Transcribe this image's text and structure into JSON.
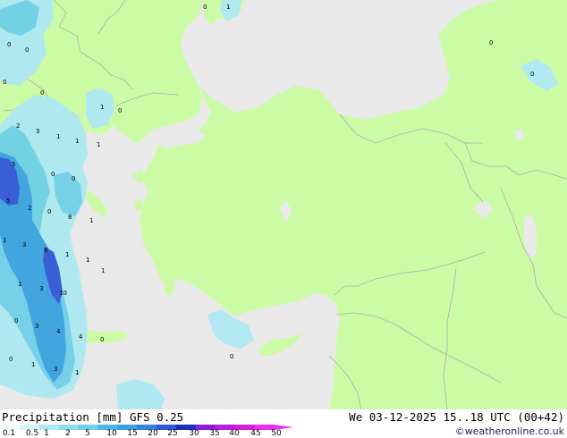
{
  "colors": {
    "sea": "#e9e9e9",
    "land": "#ccfba5",
    "border": "#aaaaaa",
    "precip_light": "#aee8f2",
    "precip_mid": "#6fcfe8",
    "precip_strong": "#3aa2e0",
    "precip_heavy": "#3256d8"
  },
  "footer": {
    "legend_title": "Precipitation [mm]  GFS 0.25",
    "run_time": "We 03-12-2025 15..18 UTC (00+42)",
    "credit": "©weatheronline.co.uk"
  },
  "legend": {
    "units": "mm",
    "ticks": [
      "0.1",
      "0.5",
      "1",
      "2",
      "5",
      "10",
      "15",
      "20",
      "25",
      "30",
      "35",
      "40",
      "45",
      "50"
    ],
    "swatches": [
      "#f6fcfe",
      "#d6f2fa",
      "#aee8f2",
      "#8fdcef",
      "#6fcfe8",
      "#4ab8e4",
      "#3aa2e0",
      "#2f86d8",
      "#3256d8",
      "#1c2fb8",
      "#8a1de0",
      "#b51ee0",
      "#d81ed8",
      "#ec2ef0"
    ]
  },
  "precip_labels": [
    {
      "text": "0"
    },
    {
      "text": "0"
    },
    {
      "text": "0"
    },
    {
      "text": "1"
    },
    {
      "text": "0"
    },
    {
      "text": "0"
    },
    {
      "text": "0"
    },
    {
      "text": "0"
    },
    {
      "text": "1"
    },
    {
      "text": "0"
    },
    {
      "text": "2"
    },
    {
      "text": "3"
    },
    {
      "text": "1"
    },
    {
      "text": "1"
    },
    {
      "text": "1"
    },
    {
      "text": "5"
    },
    {
      "text": "0"
    },
    {
      "text": "0"
    },
    {
      "text": "0"
    },
    {
      "text": "5"
    },
    {
      "text": "2"
    },
    {
      "text": "8"
    },
    {
      "text": "1"
    },
    {
      "text": "1"
    },
    {
      "text": "1"
    },
    {
      "text": "3"
    },
    {
      "text": "8"
    },
    {
      "text": "1"
    },
    {
      "text": "1"
    },
    {
      "text": "1"
    },
    {
      "text": "3"
    },
    {
      "text": "10"
    },
    {
      "text": "0"
    },
    {
      "text": "3"
    },
    {
      "text": "4"
    },
    {
      "text": "4"
    },
    {
      "text": "0"
    },
    {
      "text": "0"
    },
    {
      "text": "1"
    },
    {
      "text": "3"
    },
    {
      "text": "1"
    },
    {
      "text": "0"
    }
  ]
}
